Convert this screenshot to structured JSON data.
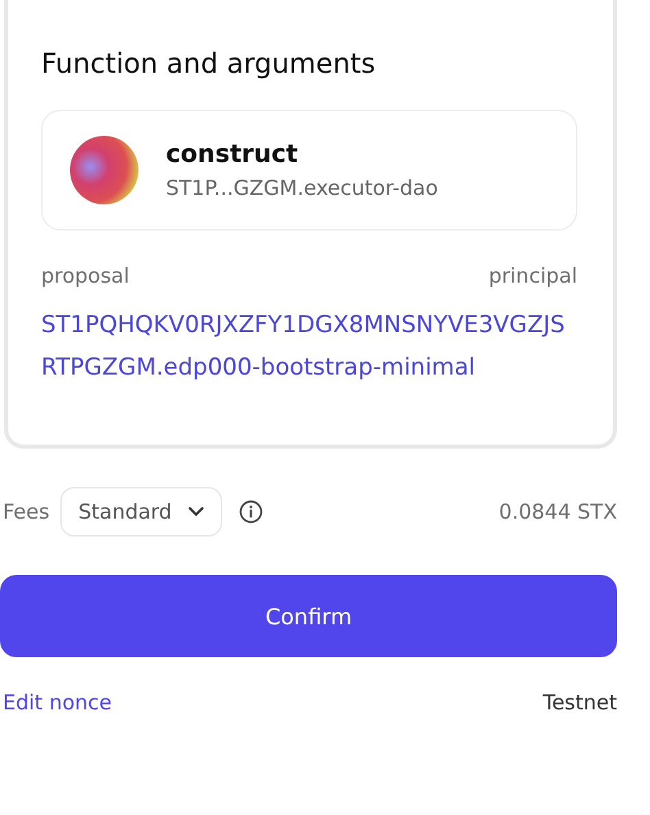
{
  "card": {
    "title": "Function and arguments",
    "function": {
      "name": "construct",
      "contract": "ST1P...GZGM.executor-dao"
    },
    "arguments": [
      {
        "name": "proposal",
        "type": "principal",
        "value": "ST1PQHQKV0RJXZFY1DGX8MNSNYVE3VGZJSRTPGZGM.edp000-bootstrap-minimal"
      }
    ]
  },
  "fees": {
    "label": "Fees",
    "option": "Standard",
    "amount": "0.0844 STX"
  },
  "confirm": "Confirm",
  "footer": {
    "link": "Edit nonce",
    "network": "Testnet"
  }
}
